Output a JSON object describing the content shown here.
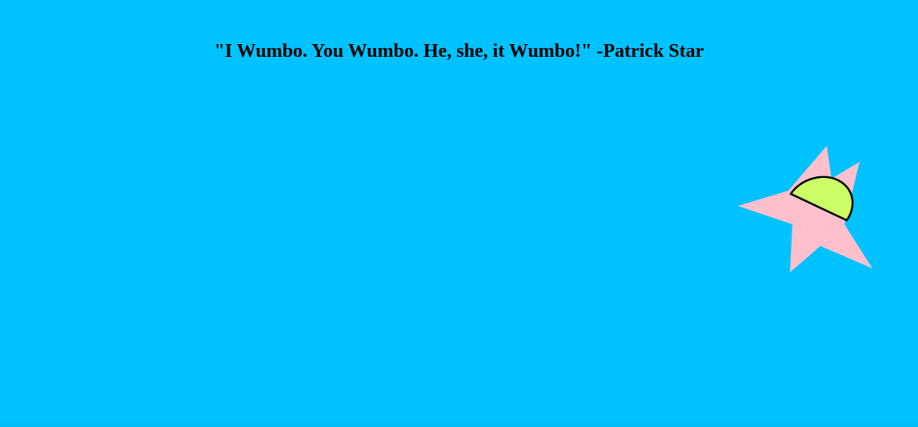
{
  "quote": {
    "text": "\"I Wumbo. You Wumbo. He, she, it Wumbo!\" -Patrick Star"
  },
  "colors": {
    "background": "#00c2fe",
    "star_body": "#ffc0cb",
    "shorts": "#ccff66",
    "outline": "#000000"
  },
  "figure": {
    "icon": "patrick-star-icon"
  }
}
